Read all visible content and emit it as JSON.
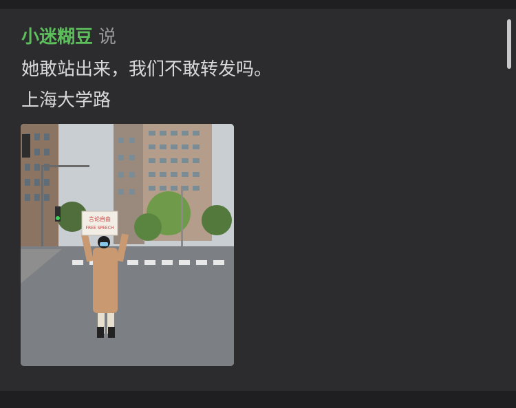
{
  "post": {
    "author": "小迷糊豆",
    "said": "说",
    "line1": "她敢站出来，我们不敢转发吗。",
    "line2": "上海大学路"
  },
  "photo": {
    "sign_text_1": "言论自由",
    "sign_text_2": "FREE SPEECH"
  },
  "colors": {
    "background": "#2c2c2e",
    "author": "#5dbf5c",
    "text": "#d8d8d8"
  }
}
